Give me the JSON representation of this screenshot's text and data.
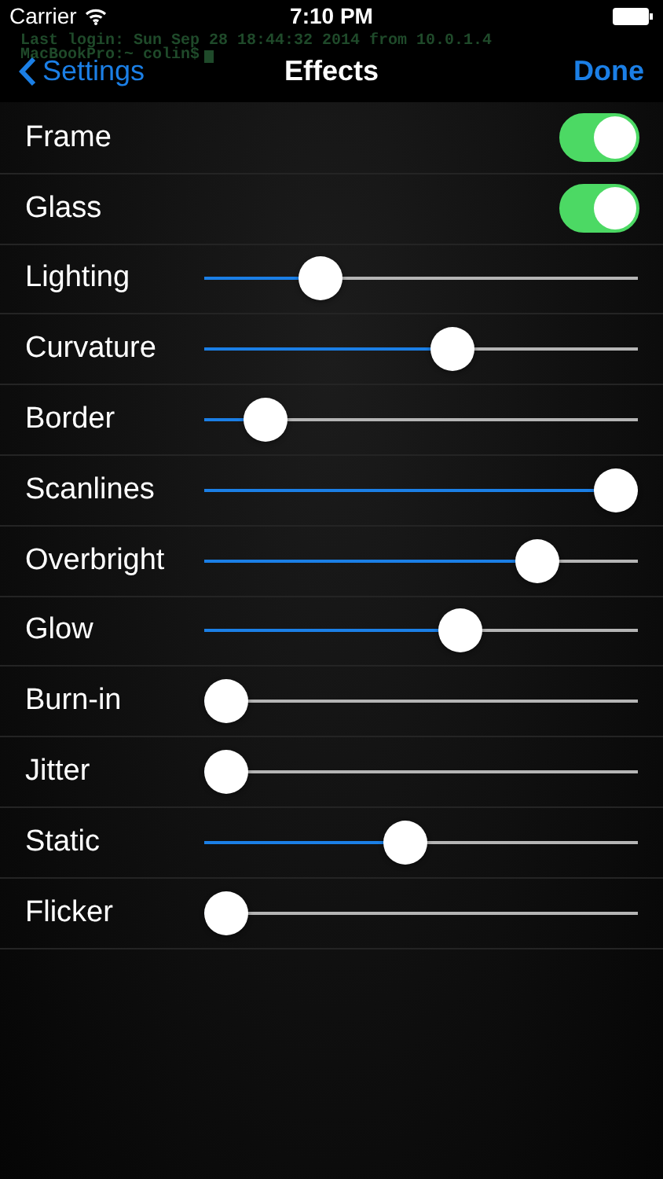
{
  "status_bar": {
    "carrier": "Carrier",
    "time": "7:10 PM"
  },
  "terminal": {
    "lines": [
      "Last login: Sun Sep 28 18:44:32 2014 from 10.0.1.4",
      "MacBookPro:~ colin$"
    ]
  },
  "nav": {
    "back": "Settings",
    "title": "Effects",
    "done": "Done"
  },
  "settings": [
    {
      "kind": "toggle",
      "label": "Frame",
      "on": true
    },
    {
      "kind": "toggle",
      "label": "Glass",
      "on": true
    },
    {
      "kind": "slider",
      "label": "Lighting",
      "level": 0.24
    },
    {
      "kind": "slider",
      "label": "Curvature",
      "level": 0.58
    },
    {
      "kind": "slider",
      "label": "Border",
      "level": 0.1
    },
    {
      "kind": "slider",
      "label": "Scanlines",
      "level": 1.0
    },
    {
      "kind": "slider",
      "label": "Overbright",
      "level": 0.8
    },
    {
      "kind": "slider",
      "label": "Glow",
      "level": 0.6
    },
    {
      "kind": "slider",
      "label": "Burn-in",
      "level": 0
    },
    {
      "kind": "slider",
      "label": "Jitter",
      "level": 0
    },
    {
      "kind": "slider",
      "label": "Static",
      "level": 0.46
    },
    {
      "kind": "slider",
      "label": "Flicker",
      "level": 0
    }
  ]
}
